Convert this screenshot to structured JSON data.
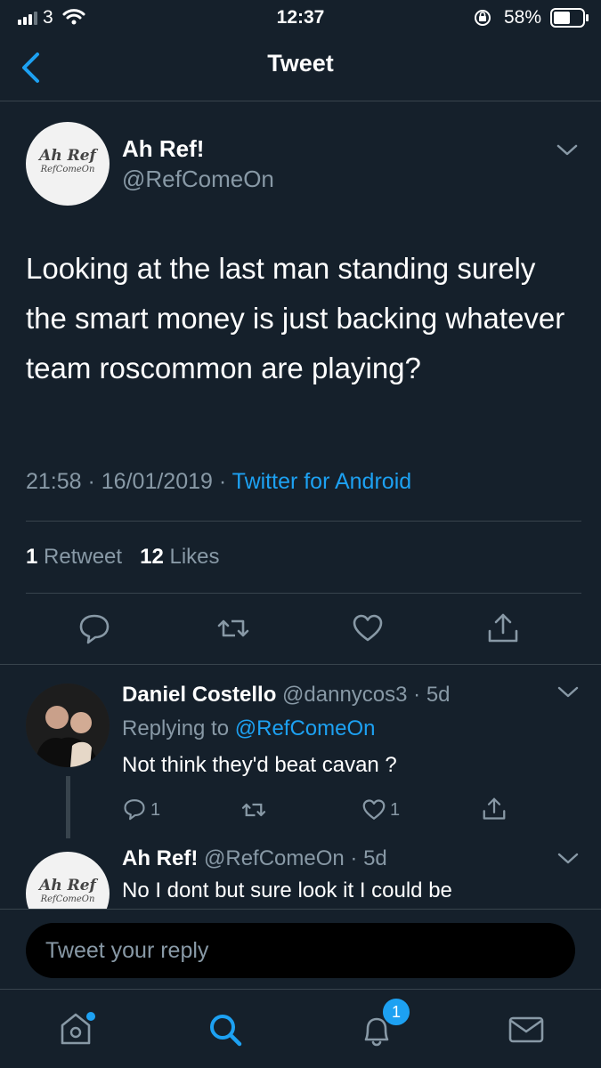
{
  "status_bar": {
    "carrier": "3",
    "time": "12:37",
    "battery": "58%",
    "battery_level": 0.58
  },
  "nav": {
    "title": "Tweet"
  },
  "tweet": {
    "author_name": "Ah Ref!",
    "author_handle": "@RefComeOn",
    "avatar_text_line1": "Ah Ref",
    "avatar_text_line2": "RefComeOn",
    "text": "Looking at the last man standing surely the smart money is just backing whatever team roscommon are playing?",
    "time": "21:58",
    "date": "16/01/2019",
    "source": "Twitter for Android",
    "retweet_count": "1",
    "retweet_label": "Retweet",
    "like_count": "12",
    "like_label": "Likes"
  },
  "replies": [
    {
      "name": "Daniel Costello",
      "handle": "@dannycos3",
      "age": "5d",
      "replying_label": "Replying to",
      "replying_to": "@RefComeOn",
      "text": "Not think they'd beat cavan ?",
      "reply_count": "1",
      "like_count": "1"
    },
    {
      "name": "Ah Ref!",
      "handle": "@RefComeOn",
      "age": "5d",
      "text": "No I dont but sure look it I could be"
    }
  ],
  "composer": {
    "placeholder": "Tweet your reply"
  },
  "tabbar": {
    "notifications_badge": "1"
  },
  "colors": {
    "background": "#15202b",
    "accent": "#1da1f2",
    "muted": "#8899a6",
    "divider": "#38444d"
  }
}
